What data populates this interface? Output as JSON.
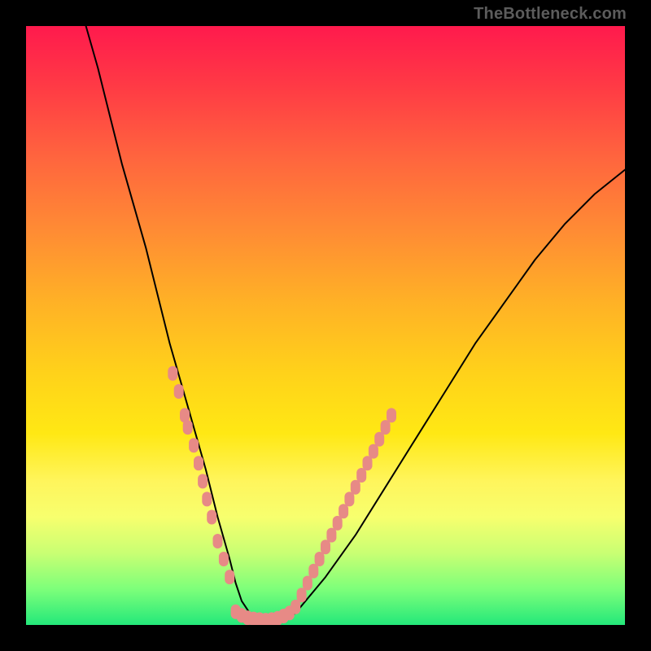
{
  "attribution": "TheBottleneck.com",
  "chart_data": {
    "type": "line",
    "title": "",
    "xlabel": "",
    "ylabel": "",
    "xlim": [
      0,
      100
    ],
    "ylim": [
      0,
      100
    ],
    "grid": false,
    "annotations": [],
    "series": [
      {
        "name": "bottleneck-curve",
        "style": "black-line",
        "x": [
          10,
          12,
          14,
          16,
          18,
          20,
          22,
          24,
          26,
          28,
          30,
          32,
          34,
          35,
          36,
          38,
          40,
          42,
          45,
          50,
          55,
          60,
          65,
          70,
          75,
          80,
          85,
          90,
          95,
          100
        ],
        "values": [
          100,
          93,
          85,
          77,
          70,
          63,
          55,
          47,
          40,
          33,
          26,
          18,
          11,
          7,
          4,
          1,
          0,
          0,
          2,
          8,
          15,
          23,
          31,
          39,
          47,
          54,
          61,
          67,
          72,
          76
        ]
      },
      {
        "name": "highlight-dots-left",
        "style": "salmon-dots",
        "x": [
          24.5,
          25.5,
          26.5,
          27,
          28,
          28.8,
          29.5,
          30.2,
          31,
          32,
          33,
          34
        ],
        "values": [
          42,
          39,
          35,
          33,
          30,
          27,
          24,
          21,
          18,
          14,
          11,
          8
        ]
      },
      {
        "name": "highlight-dots-bottom",
        "style": "salmon-dots",
        "x": [
          35,
          36,
          37,
          38,
          39,
          40,
          41,
          42,
          43,
          44
        ],
        "values": [
          2.2,
          1.6,
          1.2,
          1.0,
          0.9,
          0.8,
          0.9,
          1.1,
          1.5,
          2.0
        ]
      },
      {
        "name": "highlight-dots-right",
        "style": "salmon-dots",
        "x": [
          45,
          46,
          47,
          48,
          49,
          50,
          51,
          52,
          53,
          54,
          55,
          56,
          57,
          58,
          59,
          60,
          61
        ],
        "values": [
          3,
          5,
          7,
          9,
          11,
          13,
          15,
          17,
          19,
          21,
          23,
          25,
          27,
          29,
          31,
          33,
          35
        ]
      }
    ]
  }
}
